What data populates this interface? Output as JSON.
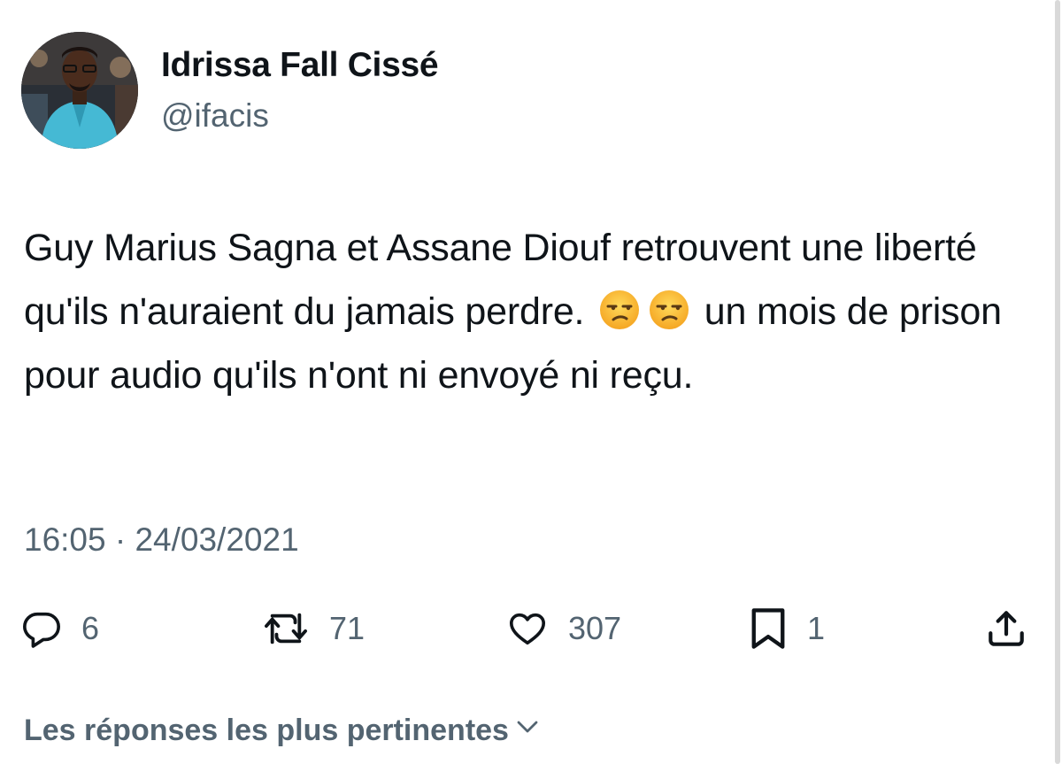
{
  "tweet": {
    "author_name": "Idrissa Fall Cissé",
    "author_handle": "@ifacis",
    "text_part1": "Guy Marius Sagna et Assane Diouf retrouvent une liberté qu'ils n'auraient du jamais perdre. ",
    "text_part2": " un mois de prison pour audio qu'ils n'ont ni envoyé ni reçu.",
    "emoji_icon": "unamused-face-icon",
    "timestamp": "16:05 · 24/03/2021"
  },
  "actions": {
    "replies": "6",
    "retweets": "71",
    "likes": "307",
    "bookmarks": "1"
  },
  "replies_sort": {
    "label": "Les réponses les plus pertinentes"
  },
  "colors": {
    "text": "#0f1419",
    "secondary": "#536471",
    "background": "#ffffff",
    "avatar_outfit": "#45b9d4"
  }
}
